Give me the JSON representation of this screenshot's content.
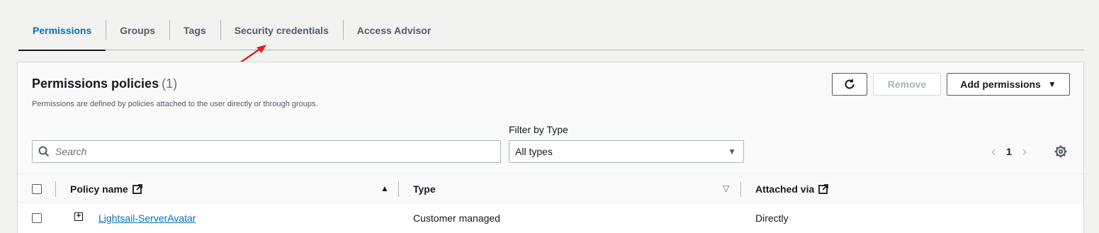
{
  "tabs": [
    {
      "label": "Permissions",
      "active": true
    },
    {
      "label": "Groups"
    },
    {
      "label": "Tags"
    },
    {
      "label": "Security credentials"
    },
    {
      "label": "Access Advisor"
    }
  ],
  "panel": {
    "title": "Permissions policies",
    "count": "(1)",
    "description": "Permissions are defined by policies attached to the user directly or through groups.",
    "refresh_icon": "refresh-icon",
    "remove_label": "Remove",
    "add_label": "Add permissions"
  },
  "filter": {
    "search_placeholder": "Search",
    "type_label": "Filter by Type",
    "type_value": "All types"
  },
  "pagination": {
    "page": "1"
  },
  "table": {
    "columns": [
      "Policy name",
      "Type",
      "Attached via"
    ],
    "rows": [
      {
        "policy_name": "Lightsail-ServerAvatar",
        "type": "Customer managed",
        "attached_via": "Directly"
      }
    ]
  },
  "colors": {
    "accent": "#0073bb",
    "annotation_arrow": "#e02020"
  }
}
